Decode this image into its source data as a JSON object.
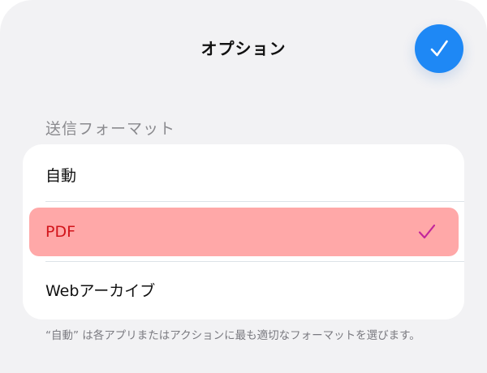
{
  "sheet": {
    "title": "オプション",
    "done_icon": "checkmark-icon"
  },
  "format_section": {
    "header": "送信フォーマット",
    "options": [
      {
        "label": "自動",
        "selected": false
      },
      {
        "label": "PDF",
        "selected": true
      },
      {
        "label": "Webアーカイブ",
        "selected": false
      }
    ],
    "selected_check_icon": "checkmark-icon",
    "footnote": "“自動” は各アプリまたはアクションに最も適切なフォーマットを選びます。"
  },
  "colors": {
    "accent_blue": "#1e88f5",
    "selected_row_bg": "#ffa8a8",
    "selected_text": "#d2151b",
    "selected_check": "#c2269b"
  }
}
